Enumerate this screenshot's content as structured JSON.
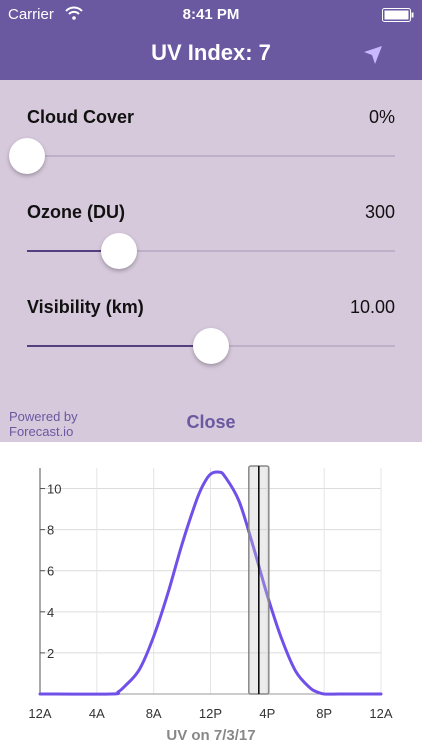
{
  "status_bar": {
    "carrier": "Carrier",
    "time": "8:41 PM",
    "wifi_icon": "wifi-icon",
    "battery_icon": "battery-icon"
  },
  "nav": {
    "title": "UV Index: 7",
    "location_icon": "location-arrow-icon"
  },
  "sliders": [
    {
      "label": "Cloud Cover",
      "value_text": "0%",
      "fraction": 0.0
    },
    {
      "label": "Ozone (DU)",
      "value_text": "300",
      "fraction": 0.25
    },
    {
      "label": "Visibility (km)",
      "value_text": "10.00",
      "fraction": 0.5
    }
  ],
  "footer": {
    "powered_by_line1": "Powered by",
    "powered_by_line2": "Forecast.io",
    "close_label": "Close"
  },
  "colors": {
    "header": "#6a58a0",
    "panel": "#d6c9dc",
    "line": "#7050e8",
    "accent_text": "#6a58a0"
  },
  "chart_data": {
    "type": "line",
    "title": "UV on 7/3/17",
    "x_ticks": [
      "12A",
      "4A",
      "8A",
      "12P",
      "4P",
      "8P",
      "12A"
    ],
    "x_hours": [
      0,
      4,
      8,
      12,
      16,
      20,
      24
    ],
    "y_ticks": [
      2,
      4,
      6,
      8,
      10
    ],
    "xlim": [
      0,
      24
    ],
    "ylim": [
      0,
      11
    ],
    "grid": true,
    "current_hour": 15.4,
    "series": [
      {
        "x": [
          0,
          5,
          5.5,
          6,
          7,
          8,
          9,
          10,
          11,
          11.5,
          12,
          12.6,
          13,
          14,
          15,
          16,
          17,
          18,
          19,
          19.5,
          20,
          21,
          22,
          24
        ],
        "y": [
          0,
          0,
          0.1,
          0.4,
          1.2,
          2.8,
          4.9,
          7.3,
          9.4,
          10.2,
          10.7,
          10.8,
          10.6,
          9.4,
          7.2,
          4.8,
          2.7,
          1.1,
          0.3,
          0.1,
          0,
          0,
          0,
          0
        ]
      }
    ]
  }
}
